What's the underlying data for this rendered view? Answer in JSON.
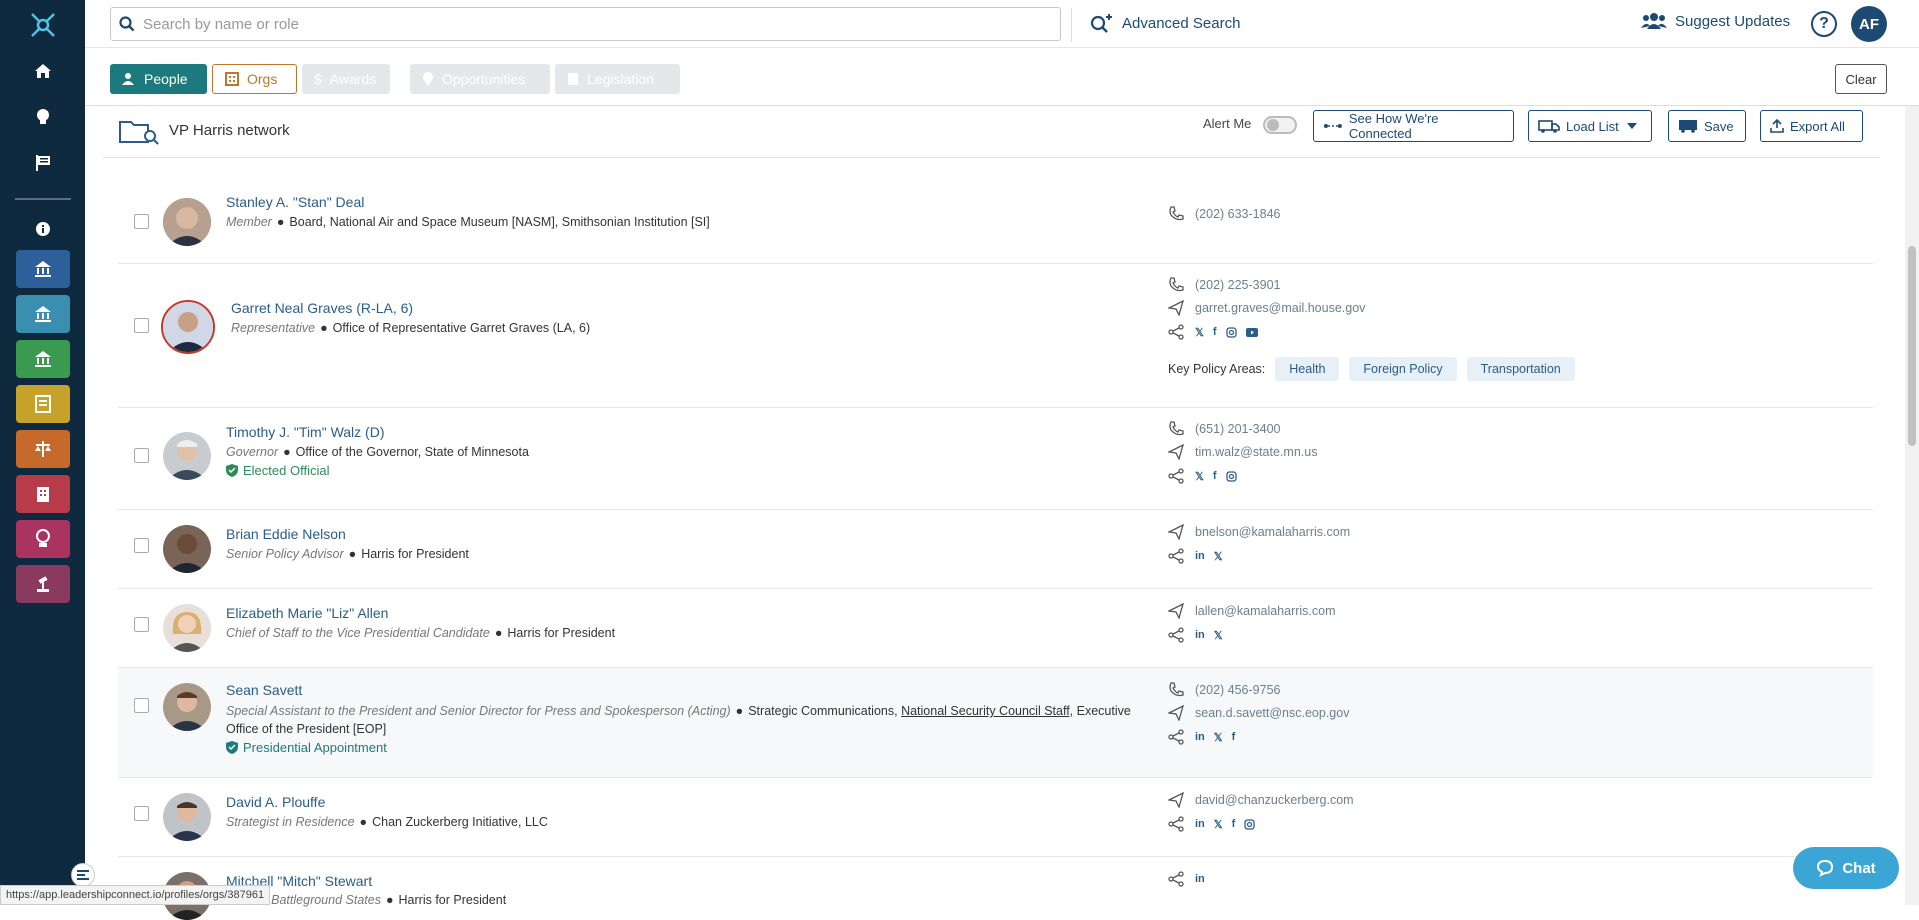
{
  "header": {
    "search_placeholder": "Search by name or role",
    "advanced_search": "Advanced Search",
    "suggest_updates": "Suggest Updates",
    "help": "?",
    "avatar_initials": "AF"
  },
  "tabs": {
    "people": "People",
    "orgs": "Orgs",
    "awards": "Awards",
    "opportunities": "Opportunities",
    "legislation": "Legislation",
    "clear": "Clear"
  },
  "list": {
    "title": "VP Harris network",
    "alert_me": "Alert Me",
    "see_connected": "See How We're Connected",
    "load_list": "Load List",
    "save": "Save",
    "export_all": "Export All"
  },
  "people": [
    {
      "name": "Stanley A. \"Stan\" Deal",
      "role": "Member",
      "org": "Board, National Air and Space Museum [NASM], Smithsonian Institution [SI]",
      "phone": "(202) 633-1846"
    },
    {
      "name": "Garret Neal Graves (R-LA, 6)",
      "role": "Representative",
      "org": "Office of Representative Garret Graves (LA, 6)",
      "phone": "(202) 225-3901",
      "email": "garret.graves@mail.house.gov",
      "policy_label": "Key Policy Areas:",
      "policy": [
        "Health",
        "Foreign Policy",
        "Transportation"
      ]
    },
    {
      "name": "Timothy J. \"Tim\" Walz (D)",
      "role": "Governor",
      "org": "Office of the Governor, State of Minnesota",
      "badge": "Elected Official",
      "phone": "(651) 201-3400",
      "email": "tim.walz@state.mn.us"
    },
    {
      "name": "Brian Eddie Nelson",
      "role": "Senior Policy Advisor",
      "org": "Harris for President",
      "email": "bnelson@kamalaharris.com"
    },
    {
      "name": "Elizabeth Marie \"Liz\" Allen",
      "role": "Chief of Staff to the Vice Presidential Candidate",
      "org": "Harris for President",
      "email": "lallen@kamalaharris.com"
    },
    {
      "name": "Sean Savett",
      "role": "Special Assistant to the President and Senior Director for Press and Spokesperson (Acting)",
      "org_a": "Strategic Communications,",
      "org_link": "National Security Council Staff,",
      "org_b": "Executive",
      "org_line2": "Office of the President [EOP]",
      "badge": "Presidential Appointment",
      "phone": "(202) 456-9756",
      "email": "sean.d.savett@nsc.eop.gov"
    },
    {
      "name": "David A. Plouffe",
      "role": "Strategist in Residence",
      "org": "Chan Zuckerberg Initiative, LLC",
      "email": "david@chanzuckerberg.com"
    },
    {
      "name": "Mitchell \"Mitch\" Stewart",
      "role": "…or for Battleground States",
      "org": "Harris for President"
    }
  ],
  "social": {
    "x": "𝕏",
    "facebook": "f",
    "linkedin": "in"
  },
  "status_url": "https://app.leadershipconnect.io/profiles/orgs/387961",
  "chat": "Chat",
  "colors": {
    "sidebar": "#0f2a3f",
    "primary": "#1d4a72",
    "teal": "#1c7a7e",
    "orange": "#c0762a",
    "link": "#2a5d8a",
    "green": "#2e8b57"
  }
}
